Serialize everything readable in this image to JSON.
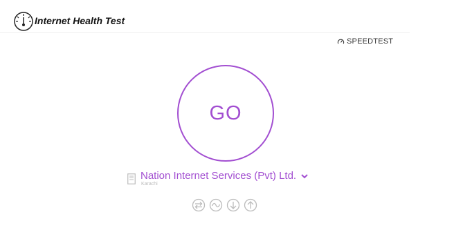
{
  "app": {
    "title": "Internet Health Test",
    "logo_icon": "speedometer-icon"
  },
  "powered_by": {
    "label": "SPEEDTEST",
    "icon": "gauge-icon"
  },
  "go_button": {
    "label": "GO"
  },
  "server": {
    "icon": "server-icon",
    "provider": "Nation Internet Services (Pvt) Ltd.",
    "location": "Karachi",
    "dropdown_icon": "chevron-down-icon"
  },
  "metrics": [
    {
      "icon": "ping-icon"
    },
    {
      "icon": "jitter-icon"
    },
    {
      "icon": "download-icon"
    },
    {
      "icon": "upload-icon"
    }
  ],
  "colors": {
    "accent": "#a24ed1",
    "icon_gray": "#bbbbbb"
  }
}
